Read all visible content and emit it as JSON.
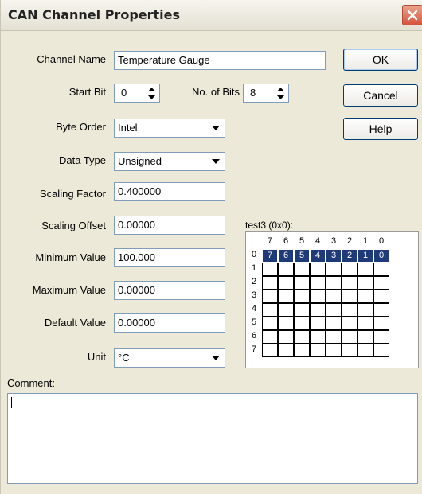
{
  "window": {
    "title": "CAN Channel Properties"
  },
  "labels": {
    "channel_name": "Channel Name",
    "start_bit": "Start Bit",
    "no_of_bits": "No. of Bits",
    "byte_order": "Byte Order",
    "data_type": "Data Type",
    "scaling_factor": "Scaling Factor",
    "scaling_offset": "Scaling Offset",
    "minimum_value": "Minimum Value",
    "maximum_value": "Maximum Value",
    "default_value": "Default Value",
    "unit": "Unit",
    "comment": "Comment:"
  },
  "values": {
    "channel_name": "Temperature Gauge",
    "start_bit": "0",
    "no_of_bits": "8",
    "byte_order": "Intel",
    "data_type": "Unsigned",
    "scaling_factor": "0.400000",
    "scaling_offset": "0.00000",
    "minimum_value": "100.000",
    "maximum_value": "0.00000",
    "default_value": "0.00000",
    "unit": "°C",
    "comment": ""
  },
  "buttons": {
    "ok": "OK",
    "cancel": "Cancel",
    "help": "Help"
  },
  "bit_grid": {
    "title": "test3 (0x0):",
    "columns": [
      "7",
      "6",
      "5",
      "4",
      "3",
      "2",
      "1",
      "0"
    ],
    "rows": [
      "0",
      "1",
      "2",
      "3",
      "4",
      "5",
      "6",
      "7"
    ],
    "highlighted_row": 0,
    "highlighted_cells": [
      "7",
      "6",
      "5",
      "4",
      "3",
      "2",
      "1",
      "0"
    ]
  },
  "colors": {
    "highlight": "#1f3a78",
    "dialog_bg": "#ece9d8"
  },
  "icons": {
    "close": "close-icon",
    "spin_up": "spin-up-icon",
    "spin_down": "spin-down-icon",
    "dropdown": "dropdown-arrow-icon"
  }
}
